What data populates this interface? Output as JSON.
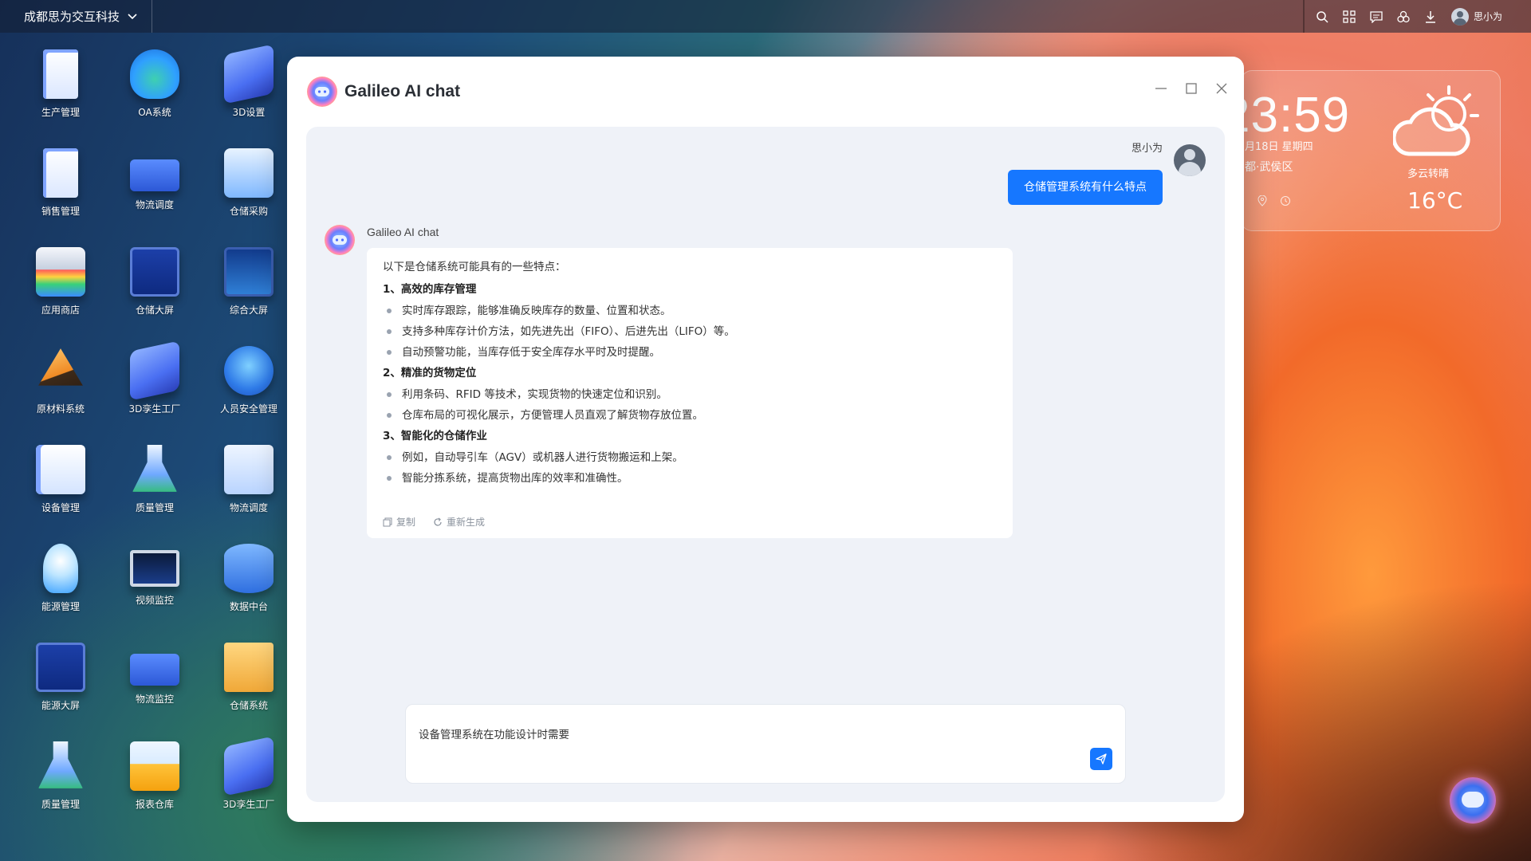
{
  "topbar": {
    "org_name": "成都思为交互科技",
    "user_name": "思小为",
    "icons": [
      "search-icon",
      "apps-icon",
      "message-icon",
      "share-icon",
      "download-icon"
    ]
  },
  "desktop": {
    "apps": [
      {
        "label": "生产管理",
        "icon": "production-icon"
      },
      {
        "label": "OA系统",
        "icon": "oa-cloud-icon"
      },
      {
        "label": "3D设置",
        "icon": "3d-settings-icon"
      },
      {
        "label": "销售管理",
        "icon": "sales-icon"
      },
      {
        "label": "物流调度",
        "icon": "truck-icon"
      },
      {
        "label": "仓储采购",
        "icon": "cart-icon"
      },
      {
        "label": "应用商店",
        "icon": "store-icon"
      },
      {
        "label": "仓储大屏",
        "icon": "screen-icon"
      },
      {
        "label": "综合大屏",
        "icon": "screen-icon"
      },
      {
        "label": "原材料系统",
        "icon": "material-icon"
      },
      {
        "label": "3D孪生工厂",
        "icon": "3d-factory-icon"
      },
      {
        "label": "人员安全管理",
        "icon": "safety-icon"
      },
      {
        "label": "设备管理",
        "icon": "device-icon"
      },
      {
        "label": "质量管理",
        "icon": "flask-icon"
      },
      {
        "label": "物流调度",
        "icon": "panel-icon"
      },
      {
        "label": "能源管理",
        "icon": "bulb-icon"
      },
      {
        "label": "视频监控",
        "icon": "monitor-icon"
      },
      {
        "label": "数据中台",
        "icon": "database-icon"
      },
      {
        "label": "能源大屏",
        "icon": "screen-icon"
      },
      {
        "label": "物流监控",
        "icon": "truck-icon"
      },
      {
        "label": "仓储系统",
        "icon": "shelf-icon"
      },
      {
        "label": "质量管理",
        "icon": "flask-icon"
      },
      {
        "label": "报表仓库",
        "icon": "folder-icon"
      },
      {
        "label": "3D孪生工厂",
        "icon": "3d-factory-icon"
      }
    ]
  },
  "weather": {
    "time": "23:59",
    "date": "月18日 星期四",
    "location": "都·武侯区",
    "condition": "多云转晴",
    "temperature": "16°C"
  },
  "chat": {
    "title": "Galileo AI chat",
    "user_name": "思小为",
    "user_message": "仓储管理系统有什么特点",
    "ai_name": "Galileo AI chat",
    "ai_intro": "以下是仓储系统可能具有的一些特点：",
    "sections": [
      {
        "title": "1、高效的库存管理",
        "items": [
          "实时库存跟踪，能够准确反映库存的数量、位置和状态。",
          "支持多种库存计价方法，如先进先出（FIFO）、后进先出（LIFO）等。",
          "自动预警功能，当库存低于安全库存水平时及时提醒。"
        ]
      },
      {
        "title": "2、精准的货物定位",
        "items": [
          "利用条码、RFID 等技术，实现货物的快速定位和识别。",
          "仓库布局的可视化展示，方便管理人员直观了解货物存放位置。"
        ]
      },
      {
        "title": "3、智能化的仓储作业",
        "items": [
          "例如，自动导引车（AGV）或机器人进行货物搬运和上架。",
          "智能分拣系统，提高货物出库的效率和准确性。"
        ]
      }
    ],
    "actions": {
      "copy": "复制",
      "regenerate": "重新生成"
    },
    "input_value": "设备管理系统在功能设计时需要"
  },
  "colors": {
    "accent": "#1677ff",
    "chat_bg": "#eff2f8"
  }
}
